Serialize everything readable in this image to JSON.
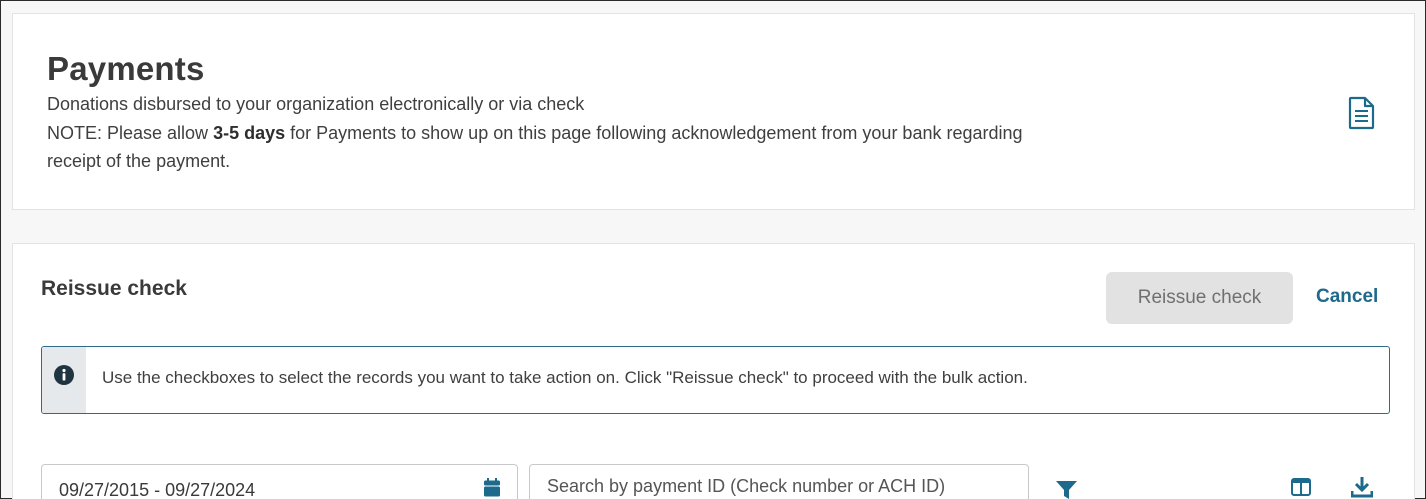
{
  "header": {
    "title": "Payments",
    "subtitle": "Donations disbursed to your organization electronically or via check",
    "note_prefix": "NOTE: Please allow ",
    "note_bold": "3-5 days",
    "note_suffix": " for Payments to show up on this page following acknowledgement from your bank regarding receipt of the payment.",
    "doc_icon": "document-icon"
  },
  "reissue": {
    "section_title": "Reissue check",
    "reissue_button_label": "Reissue check",
    "cancel_label": "Cancel",
    "info_message": "Use the checkboxes to select the records you want to take action on. Click \"Reissue check\" to proceed with the bulk action.",
    "info_icon": "info-icon"
  },
  "filters": {
    "date_range": "09/27/2015 - 09/27/2024",
    "search_placeholder": "Search by payment ID (Check number or ACH ID)",
    "icons": [
      "calendar-icon",
      "filter-icon",
      "columns-icon",
      "download-icon"
    ]
  },
  "colors": {
    "accent": "#1d6a8c",
    "banner_border": "#2d6b87",
    "disabled_button": "#e2e2e2"
  }
}
